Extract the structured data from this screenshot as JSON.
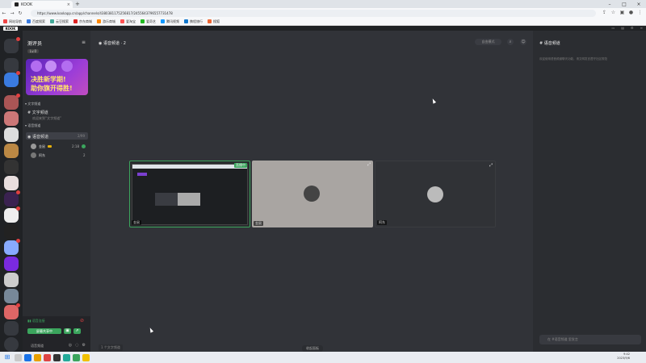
{
  "browser": {
    "tab_title": "KOOK",
    "url": "https://www.kookapp.cn/app/channels/4380381175256817/2455643796557731478",
    "bookmarks": [
      "网站导航",
      "百度搜索",
      "云豆搜索",
      "京东商城",
      "游乐商城",
      "爱淘宝",
      "爱奇艺",
      "腾讯视频",
      "携程旅行",
      "搜狐"
    ]
  },
  "app": {
    "logo": "KOOK",
    "server_name": "测评员",
    "server_tag": "Lv.0",
    "banner_line1": "决胜新学期!",
    "banner_line2": "助你旗开得胜!",
    "category_text": "文字频道",
    "text_channel": "文字频道",
    "text_channel_sub": "欢迎来到“文字频道”",
    "category_voice": "语音频道",
    "voice_channel": "语音频道",
    "voice_channel_count": "2/99",
    "members": [
      {
        "name": "金鼠",
        "count": "2:18"
      },
      {
        "name": "阿东",
        "count": "2"
      }
    ],
    "voice_panel": {
      "status": "语音连接",
      "share_button": "屏幕共享中",
      "user": "语音频道"
    },
    "header_title": "语音频道 · 2",
    "header_pill": "自由模式",
    "tiles": [
      {
        "label": "金鼠",
        "tag": "直播中"
      },
      {
        "label": "金鼠"
      },
      {
        "label": "阿东"
      }
    ],
    "status_hint": "1 个文字频道",
    "scroll_hint": "收起面板",
    "right_panel_title": "语音频道",
    "right_panel_note": "欢迎使用语音频道聊天功能，请文明发言遵守社区规范",
    "chat_placeholder": "在 #语音频道 里发言"
  },
  "taskbar": {
    "time": "9:42",
    "date": "2023/9/6"
  },
  "colors": {
    "accent_green": "#3ba55d",
    "badge_red": "#e04040"
  }
}
